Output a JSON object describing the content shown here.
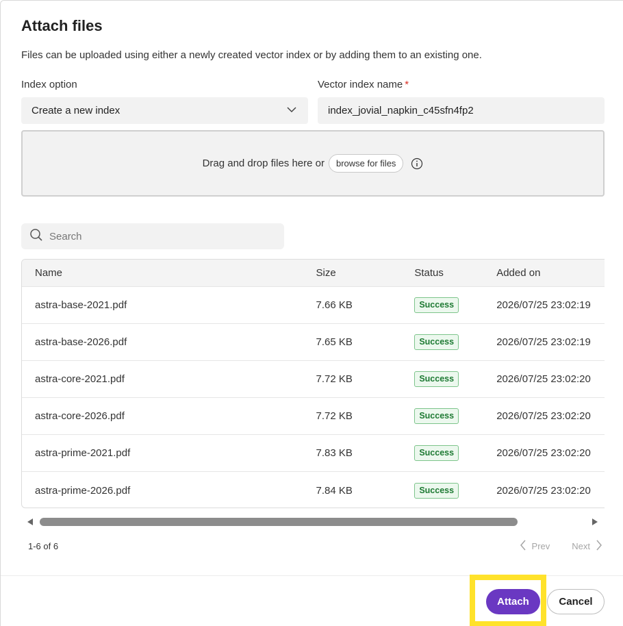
{
  "dialog": {
    "title": "Attach files",
    "description": "Files can be uploaded using either a newly created vector index or by adding them to an existing one."
  },
  "index_option": {
    "label": "Index option",
    "selected": "Create a new index"
  },
  "vector_index": {
    "label": "Vector index name",
    "required_marker": "*",
    "value": "index_jovial_napkin_c45sfn4fp2"
  },
  "dropzone": {
    "text": "Drag and drop files here or",
    "browse_label": "browse for files"
  },
  "search": {
    "placeholder": "Search"
  },
  "table": {
    "columns": [
      "Name",
      "Size",
      "Status",
      "Added on"
    ],
    "rows": [
      {
        "name": "astra-base-2021.pdf",
        "size": "7.66 KB",
        "status": "Success",
        "added_on": "2026/07/25 23:02:19"
      },
      {
        "name": "astra-base-2026.pdf",
        "size": "7.65 KB",
        "status": "Success",
        "added_on": "2026/07/25 23:02:19"
      },
      {
        "name": "astra-core-2021.pdf",
        "size": "7.72 KB",
        "status": "Success",
        "added_on": "2026/07/25 23:02:20"
      },
      {
        "name": "astra-core-2026.pdf",
        "size": "7.72 KB",
        "status": "Success",
        "added_on": "2026/07/25 23:02:20"
      },
      {
        "name": "astra-prime-2021.pdf",
        "size": "7.83 KB",
        "status": "Success",
        "added_on": "2026/07/25 23:02:20"
      },
      {
        "name": "astra-prime-2026.pdf",
        "size": "7.84 KB",
        "status": "Success",
        "added_on": "2026/07/25 23:02:20"
      }
    ]
  },
  "pagination": {
    "info": "1-6 of 6",
    "prev_label": "Prev",
    "next_label": "Next"
  },
  "footer": {
    "attach_label": "Attach",
    "cancel_label": "Cancel"
  },
  "colors": {
    "accent": "#6a38c2",
    "success_text": "#1e7a33",
    "highlight": "#ffe22b",
    "required": "#d93025"
  },
  "icons": {
    "select": "chevron-down-icon",
    "info": "info-icon",
    "search": "search-icon",
    "prev": "chevron-left-icon",
    "next": "chevron-right-icon"
  }
}
